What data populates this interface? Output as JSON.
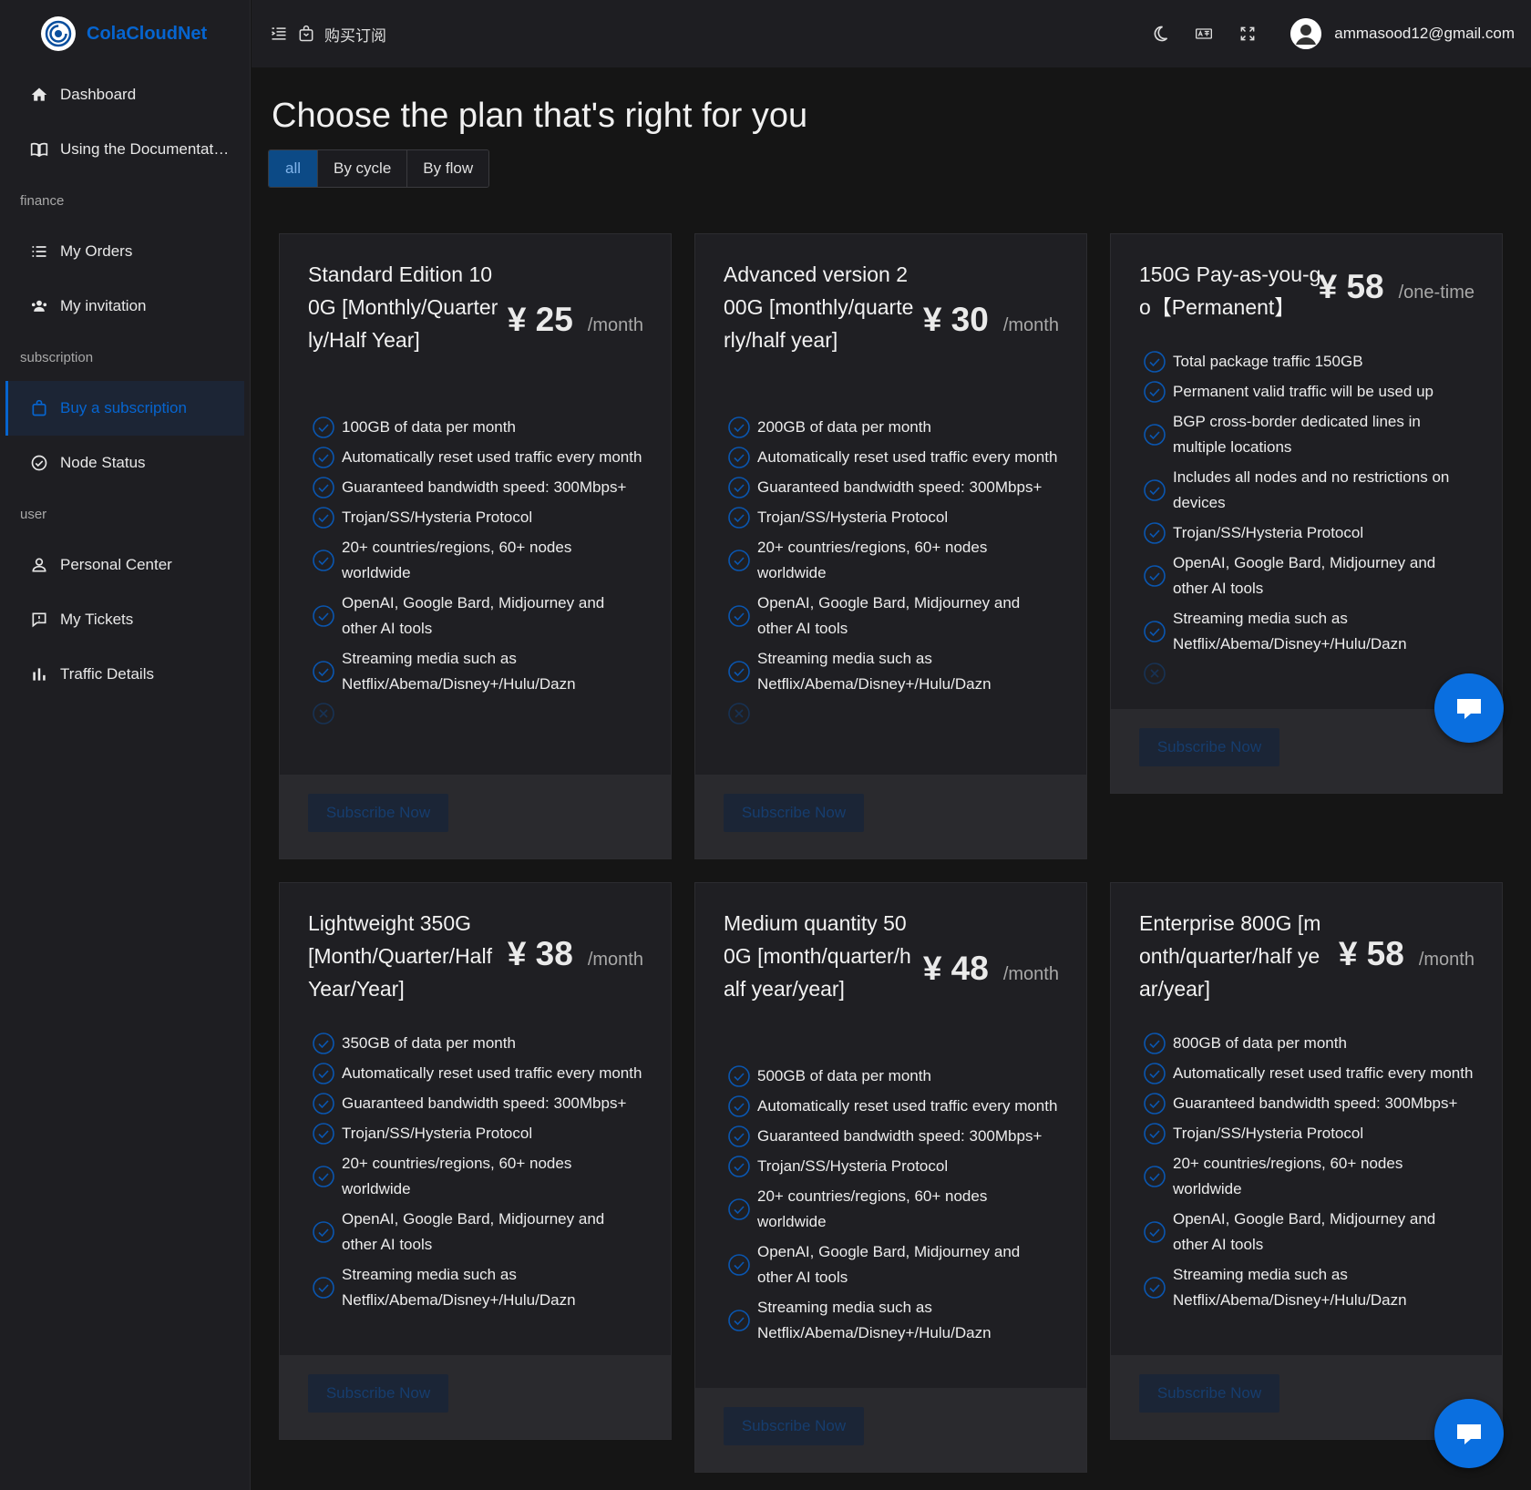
{
  "brand": {
    "name": "ColaCloudNet"
  },
  "sidebar": {
    "items": [
      {
        "label": "Dashboard",
        "icon": "home-icon"
      },
      {
        "label": "Using the Documentat…",
        "icon": "book-icon"
      },
      {
        "section": "finance"
      },
      {
        "label": "My Orders",
        "icon": "list-icon"
      },
      {
        "label": "My invitation",
        "icon": "group-icon"
      },
      {
        "section": "subscription"
      },
      {
        "label": "Buy a subscription",
        "icon": "bag-icon",
        "active": true
      },
      {
        "label": "Node Status",
        "icon": "check-circle-icon"
      },
      {
        "section": "user"
      },
      {
        "label": "Personal Center",
        "icon": "person-icon"
      },
      {
        "label": "My Tickets",
        "icon": "ticket-icon"
      },
      {
        "label": "Traffic Details",
        "icon": "bar-chart-icon"
      }
    ]
  },
  "header": {
    "breadcrumb": "购买订阅",
    "user_email": "ammasood12@gmail.com"
  },
  "main": {
    "title": "Choose the plan that's right for you",
    "filters": [
      "all",
      "By cycle",
      "By flow"
    ],
    "active_filter": "all",
    "subscribe_label": "Subscribe Now",
    "plans": [
      {
        "name": "Standard Edition 100G [Monthly/Quarterly/Half Year]",
        "price": "¥ 25",
        "period": "/month",
        "features": [
          "100GB of data per month",
          "Automatically reset used traffic every month",
          "Guaranteed bandwidth speed: 300Mbps+",
          "Trojan/SS/Hysteria Protocol",
          "20+ countries/regions, 60+ nodes worldwide",
          "OpenAI, Google Bard, Midjourney and other AI tools",
          "Streaming media such as Netflix/Abema/Disney+/Hulu/Dazn"
        ]
      },
      {
        "name": "Advanced version 200G [monthly/quarterly/half year]",
        "price": "¥ 30",
        "period": "/month",
        "features": [
          "200GB of data per month",
          "Automatically reset used traffic every month",
          "Guaranteed bandwidth speed: 300Mbps+",
          "Trojan/SS/Hysteria Protocol",
          "20+ countries/regions, 60+ nodes worldwide",
          "OpenAI, Google Bard, Midjourney and other AI tools",
          "Streaming media such as Netflix/Abema/Disney+/Hulu/Dazn"
        ]
      },
      {
        "name": "150G Pay-as-you-go【Permanent】",
        "price": "¥ 58",
        "period": "/one-time",
        "features": [
          "Total package traffic 150GB",
          "Permanent valid traffic will be used up",
          "BGP cross-border dedicated lines in multiple locations",
          "Includes all nodes and no restrictions on devices",
          "Trojan/SS/Hysteria Protocol",
          "OpenAI, Google Bard, Midjourney and other AI tools",
          "Streaming media such as Netflix/Abema/Disney+/Hulu/Dazn"
        ]
      },
      {
        "name": "Lightweight 350G [Month/Quarter/Half Year/Year]",
        "price": "¥ 38",
        "period": "/month",
        "features": [
          "350GB of data per month",
          "Automatically reset used traffic every month",
          "Guaranteed bandwidth speed: 300Mbps+",
          "Trojan/SS/Hysteria Protocol",
          "20+ countries/regions, 60+ nodes worldwide",
          "OpenAI, Google Bard, Midjourney and other AI tools",
          "Streaming media such as Netflix/Abema/Disney+/Hulu/Dazn"
        ]
      },
      {
        "name": "Medium quantity 500G [month/quarter/half year/year]",
        "price": "¥ 48",
        "period": "/month",
        "features": [
          "500GB of data per month",
          "Automatically reset used traffic every month",
          "Guaranteed bandwidth speed: 300Mbps+",
          "Trojan/SS/Hysteria Protocol",
          "20+ countries/regions, 60+ nodes worldwide",
          "OpenAI, Google Bard, Midjourney and other AI tools",
          "Streaming media such as Netflix/Abema/Disney+/Hulu/Dazn"
        ]
      },
      {
        "name": "Enterprise 800G [month/quarter/half year/year]",
        "price": "¥ 58",
        "period": "/month",
        "features": [
          "800GB of data per month",
          "Automatically reset used traffic every month",
          "Guaranteed bandwidth speed: 300Mbps+",
          "Trojan/SS/Hysteria Protocol",
          "20+ countries/regions, 60+ nodes worldwide",
          "OpenAI, Google Bard, Midjourney and other AI tools",
          "Streaming media such as Netflix/Abema/Disney+/Hulu/Dazn"
        ]
      }
    ]
  },
  "colors": {
    "accent": "#0665d0",
    "fab": "#0a6fe0",
    "background": "#151515",
    "card": "#1f1f23"
  }
}
